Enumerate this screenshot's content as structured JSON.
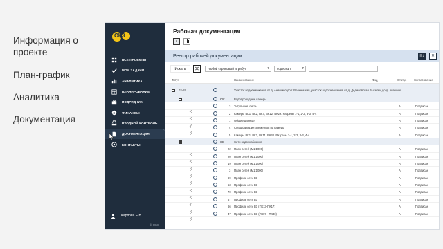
{
  "features": [
    "Информация о проекте",
    "План-график",
    "Аналитика",
    "Документация"
  ],
  "logo": {
    "text": "ОКЭ"
  },
  "sidebar": {
    "items": [
      {
        "label": "ВСЕ ПРОЕКТЫ",
        "icon": "grid-icon"
      },
      {
        "label": "МОИ ЗАДАЧИ",
        "icon": "check-icon"
      },
      {
        "label": "АНАЛИТИКА",
        "icon": "chart-icon"
      },
      {
        "label": "ПЛАНИРОВАНИЕ",
        "icon": "dashboard-icon"
      },
      {
        "label": "ПОДРЯДЧИК",
        "icon": "briefcase-icon"
      },
      {
        "label": "ФИНАНСЫ",
        "icon": "money-icon"
      },
      {
        "label": "ВХОДНОЙ КОНТРОЛЬ",
        "icon": "inbox-icon"
      },
      {
        "label": "ДОКУМЕНТАЦИЯ",
        "icon": "document-icon"
      },
      {
        "label": "КОНТАКТЫ",
        "icon": "at-icon"
      }
    ],
    "active_index": 7,
    "user": "Карпова Е.В.",
    "copyright": "© ОКЭ"
  },
  "main": {
    "title": "Рабочая документация",
    "back": "‹"
  },
  "panel": {
    "title": "Реестр рабочей документации",
    "tool_export": "≡↓",
    "tool_close": "✕"
  },
  "filters": {
    "search_button": "Искать",
    "clear": "✕",
    "field": "Любой строковый атрибут",
    "operator": "содержит",
    "value": ""
  },
  "columns": {
    "title": "Титул",
    "name": "Наименование",
    "format": "Фзд",
    "status": "Статус",
    "approval": "Согласование"
  },
  "rows": [
    {
      "type": "group",
      "tall": true,
      "code": "02-19",
      "name": "Участок водоснабжения от д. Анашино до г. Вольницкий, участок водоснабжения от д. Дедиловская Выселки до д. Анашино"
    },
    {
      "type": "group",
      "code": "ЮК",
      "name": "Водопроводные камеры"
    },
    {
      "type": "doc",
      "num": "3",
      "name": "Титульные листы",
      "status": "А",
      "approval": "Подписан"
    },
    {
      "type": "doc",
      "num": "2",
      "name": "Камеры ВК1, ВК2, ВК7, ВК12, ВК29. Разрезы 1-1, 2-2, 3-3, 4-4",
      "status": "А",
      "approval": "Подписан"
    },
    {
      "type": "doc",
      "num": "1",
      "name": "Общие данные",
      "status": "А",
      "approval": "Подписан"
    },
    {
      "type": "doc",
      "num": "4",
      "name": "Спецификация элементов на камеры",
      "status": "А",
      "approval": "Подписан"
    },
    {
      "type": "doc",
      "num": "5",
      "name": "Камеры ВК1, ВК2, ВК11, ВК30. Разрезы 1-1, 2-2, 3-3, 4-4",
      "status": "А",
      "approval": "Подписан"
    },
    {
      "type": "group",
      "code": "НВ",
      "name": "Сети водоснабжения"
    },
    {
      "type": "doc",
      "num": "22",
      "name": "План сетей (М1:1000)",
      "status": "А",
      "approval": "Подписан"
    },
    {
      "type": "doc",
      "num": "20",
      "name": "План сетей (М1:1000)",
      "status": "А",
      "approval": "Подписан"
    },
    {
      "type": "doc",
      "num": "19",
      "name": "План сетей (М1:1000)",
      "status": "А",
      "approval": "Подписан"
    },
    {
      "type": "doc",
      "num": "3",
      "name": "План сетей (М1:1000)",
      "status": "А",
      "approval": "Подписан"
    },
    {
      "type": "doc",
      "num": "69",
      "name": "Профиль сети В1",
      "status": "А",
      "approval": "Подписан"
    },
    {
      "type": "doc",
      "num": "53",
      "name": "Профиль сети В1",
      "status": "А",
      "approval": "Подписан"
    },
    {
      "type": "doc",
      "num": "70",
      "name": "Профиль сети В1",
      "status": "А",
      "approval": "Подписан"
    },
    {
      "type": "doc",
      "num": "57",
      "name": "Профиль сети В1",
      "status": "А",
      "approval": "Подписан"
    },
    {
      "type": "doc",
      "num": "66",
      "name": "Профиль сети В1 (ПК13-ПК17)",
      "status": "А",
      "approval": "Подписан"
    },
    {
      "type": "doc",
      "num": "47",
      "name": "Профиль сети В1 (ПК07 - ПК40)",
      "status": "А",
      "approval": "Подписан"
    }
  ],
  "colors": {
    "sidebar_bg": "#1f2d3d",
    "panel_head_bg": "#d6e1ef",
    "logo_yellow": "#f3c417",
    "group_row_bg": "#e9eef5"
  }
}
